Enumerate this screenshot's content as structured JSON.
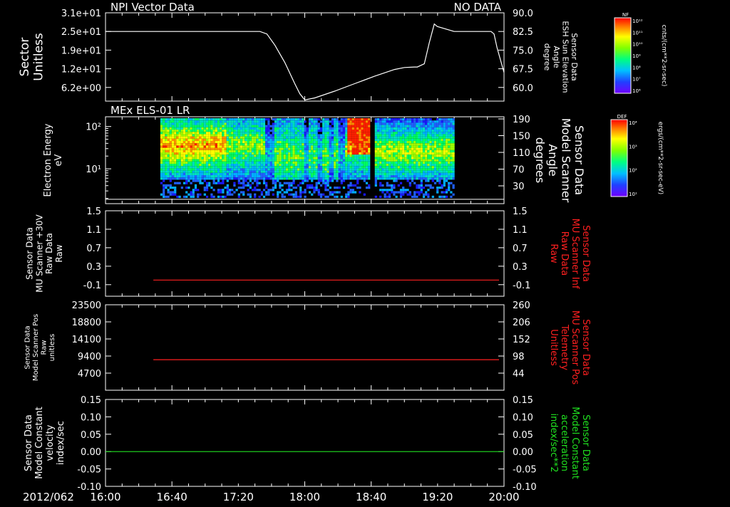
{
  "date_label": "2012/062",
  "time_axis": {
    "range": [
      "16:00",
      "20:00"
    ],
    "ticks": [
      "16:00",
      "16:40",
      "17:20",
      "18:00",
      "18:40",
      "19:20",
      "20:00"
    ],
    "tick_hours": [
      16.0,
      16.6667,
      17.3333,
      18.0,
      18.6667,
      19.3333,
      20.0
    ]
  },
  "colors": {
    "background": "#000000",
    "foreground": "#ffffff",
    "red_series": "#ff2020",
    "green_series": "#20e020"
  },
  "colorbars": [
    {
      "label": "NF",
      "units": "cnts/(cm**2-sr-sec)",
      "ticks": [
        "10¹²",
        "10¹¹",
        "10¹⁰",
        "10⁹",
        "10⁸",
        "10⁷",
        "10⁶"
      ]
    },
    {
      "label": "DEF",
      "units": "ergs/(cm**2-sr-sec-eV)",
      "ticks": [
        "10⁴",
        "10³",
        "10²",
        "10¹"
      ]
    }
  ],
  "chart_data": [
    {
      "type": "line",
      "title": "NPI Vector Data",
      "status": "NO DATA",
      "ylabel_left": [
        "Sector",
        "Unitless"
      ],
      "yticks_left": [
        "3.1e+01",
        "2.5e+01",
        "1.9e+01",
        "1.2e+01",
        "6.2e+00"
      ],
      "ylabel_right": [
        "Sensor Data",
        "ESH Sun Elevation",
        "Angle",
        "degree"
      ],
      "yticks_right": [
        "90.0",
        "82.5",
        "75.0",
        "67.5",
        "60.0"
      ],
      "ylim_right": [
        54.5,
        90.0
      ],
      "right_tick_values": [
        90.0,
        82.5,
        75.0,
        67.5,
        60.0
      ],
      "series": [
        {
          "axis": "right",
          "x": [
            16.0,
            17.0,
            17.3,
            17.55,
            17.62,
            17.7,
            17.8,
            17.9,
            17.95,
            18.0,
            18.1,
            18.3,
            18.5,
            18.7,
            18.9,
            19.0,
            19.1,
            19.13,
            19.2,
            19.25,
            19.3,
            19.33,
            19.5,
            19.8,
            19.87,
            19.9,
            19.93,
            20.0
          ],
          "y": [
            82.5,
            82.5,
            82.5,
            82.5,
            81.5,
            77.0,
            70.0,
            61.5,
            57.5,
            55.0,
            55.8,
            58.5,
            61.5,
            64.5,
            67.2,
            68.0,
            68.2,
            68.2,
            69.5,
            78.0,
            85.5,
            84.5,
            82.5,
            82.5,
            82.5,
            81.5,
            76.0,
            66.0
          ]
        }
      ]
    },
    {
      "type": "heatmap",
      "title": "MEx ELS-01 LR",
      "ylabel_left": [
        "Electron Energy",
        "eV"
      ],
      "yticks_left": [
        "10²",
        "10¹"
      ],
      "ytick_values_left": [
        100,
        10
      ],
      "ylim_left": [
        1.5,
        170
      ],
      "ylabel_right": [
        "Sensor Data",
        "Model Scanner",
        "Angle",
        "degrees"
      ],
      "yticks_right": [
        "190",
        "150",
        "110",
        "70",
        "30"
      ],
      "data_coverage": [
        16.55,
        19.5
      ],
      "spikes": [
        17.7,
        17.75,
        17.8,
        17.84,
        17.9,
        17.95,
        18.05,
        18.1,
        18.2,
        18.3
      ],
      "red_region": [
        18.42,
        18.67
      ],
      "gap": [
        18.65,
        18.69
      ],
      "baseline_energy": 1.9
    },
    {
      "type": "line",
      "ylabel_left": [
        "Sensor Data",
        "MU Scanner +30V",
        "Raw Data",
        "Raw"
      ],
      "yticks_left": [
        "1.5",
        "1.1",
        "0.7",
        "0.3",
        "-0.1"
      ],
      "ylabel_right": [
        "Sensor Data",
        "MU Scanner Inf",
        "Raw Data",
        "Raw"
      ],
      "yticks_right": [
        "1.5",
        "1.1",
        "0.7",
        "0.3",
        "-0.1"
      ],
      "ylim": [
        -0.35,
        1.5
      ],
      "tick_values": [
        1.5,
        1.1,
        0.7,
        0.3,
        -0.1
      ],
      "series": [
        {
          "axis": "left",
          "color": "#ff2020",
          "x": [
            16.48,
            19.95
          ],
          "y": [
            0.0,
            0.0
          ]
        }
      ]
    },
    {
      "type": "line",
      "ylabel_left": [
        "Sensor Data",
        "Model Scanner Pos",
        "Raw",
        "unitless"
      ],
      "yticks_left": [
        "23500",
        "18800",
        "14100",
        "9400",
        "4700"
      ],
      "ylabel_right": [
        "Sensor Data",
        "MU Scanner Pos",
        "Telemetry",
        "Unitless"
      ],
      "yticks_right": [
        "260",
        "206",
        "152",
        "98",
        "44"
      ],
      "ylim": [
        0,
        23500
      ],
      "tick_values": [
        23500,
        18800,
        14100,
        9400,
        4700
      ],
      "series": [
        {
          "axis": "left",
          "color": "#ff2020",
          "x": [
            16.48,
            19.95
          ],
          "y": [
            8400,
            8400
          ]
        }
      ]
    },
    {
      "type": "line",
      "ylabel_left": [
        "Sensor Data",
        "Model Constant",
        "velocity",
        "index/sec"
      ],
      "yticks_left": [
        "0.15",
        "0.10",
        "0.05",
        "0.00",
        "-0.05",
        "-0.10"
      ],
      "ylabel_right": [
        "Sensor Data",
        "Model Constant",
        "acceleration",
        "index/sec**2"
      ],
      "yticks_right": [
        "0.15",
        "0.10",
        "0.05",
        "0.00",
        "-0.05",
        "-0.10"
      ],
      "ylim": [
        -0.1,
        0.15
      ],
      "tick_values": [
        0.15,
        0.1,
        0.05,
        0.0,
        -0.05,
        -0.1
      ],
      "series": [
        {
          "axis": "left",
          "color": "#20e020",
          "x": [
            16.0,
            20.0
          ],
          "y": [
            0.0,
            0.0
          ]
        }
      ]
    }
  ]
}
